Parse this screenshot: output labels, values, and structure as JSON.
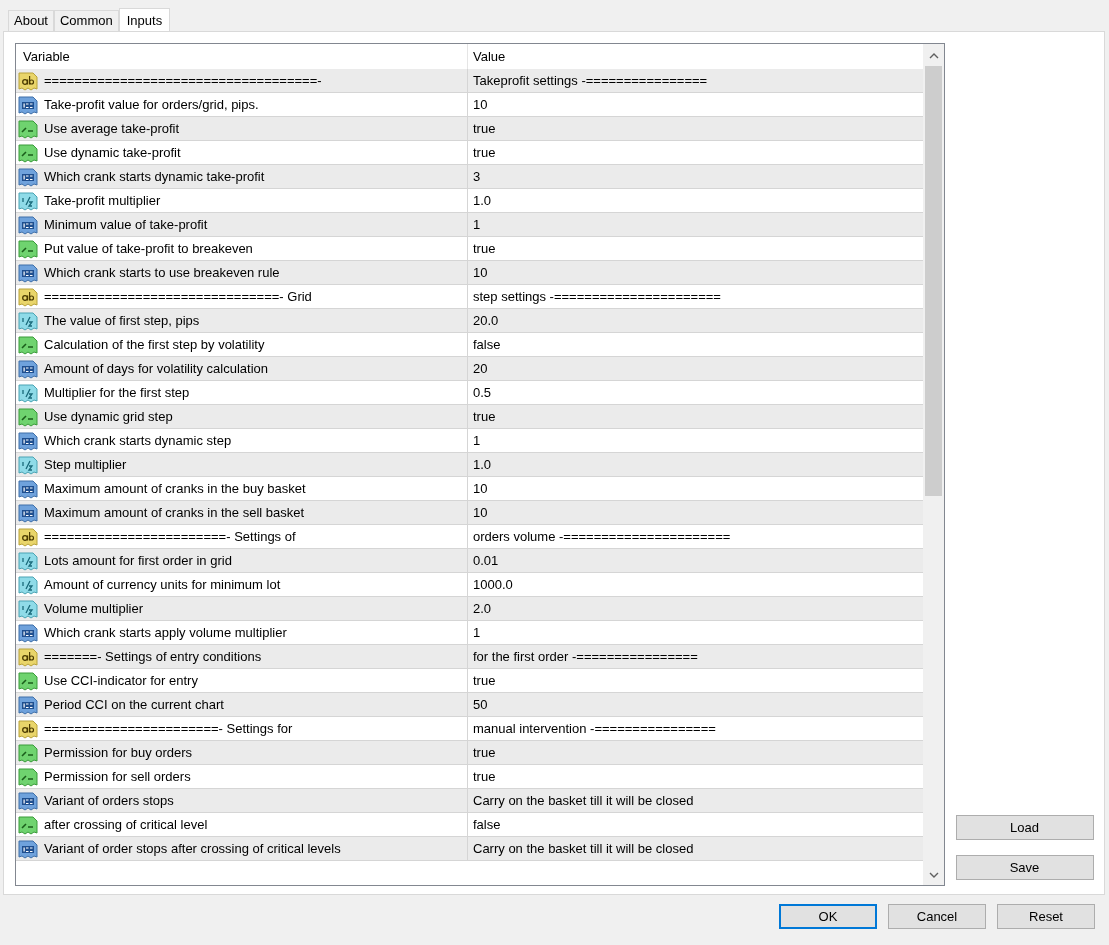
{
  "tabs": [
    {
      "label": "About",
      "selected": false
    },
    {
      "label": "Common",
      "selected": false
    },
    {
      "label": "Inputs",
      "selected": true
    }
  ],
  "table": {
    "columns": [
      "Variable",
      "Value"
    ],
    "rows": [
      {
        "kind": "string",
        "variable": "====================================-",
        "value": "Takeprofit settings -================"
      },
      {
        "kind": "int",
        "variable": "Take-profit value for orders/grid, pips.",
        "value": "10"
      },
      {
        "kind": "bool",
        "variable": "Use average take-profit",
        "value": "true"
      },
      {
        "kind": "bool",
        "variable": "Use dynamic take-profit",
        "value": "true"
      },
      {
        "kind": "int",
        "variable": "Which crank starts dynamic take-profit",
        "value": "3"
      },
      {
        "kind": "double",
        "variable": "Take-profit multiplier",
        "value": "1.0"
      },
      {
        "kind": "int",
        "variable": "Minimum value of take-profit",
        "value": "1"
      },
      {
        "kind": "bool",
        "variable": "Put value of take-profit to breakeven",
        "value": "true"
      },
      {
        "kind": "int",
        "variable": "Which crank starts to use breakeven rule",
        "value": "10"
      },
      {
        "kind": "string",
        "variable": "===============================- Grid",
        "value": "step settings -======================"
      },
      {
        "kind": "double",
        "variable": "The value of first step, pips",
        "value": "20.0"
      },
      {
        "kind": "bool",
        "variable": "Calculation of the first step by volatility",
        "value": "false"
      },
      {
        "kind": "int",
        "variable": "Amount of days for volatility calculation",
        "value": "20"
      },
      {
        "kind": "double",
        "variable": "Multiplier for the first step",
        "value": "0.5"
      },
      {
        "kind": "bool",
        "variable": "Use dynamic grid step",
        "value": "true"
      },
      {
        "kind": "int",
        "variable": "Which crank starts dynamic step",
        "value": "1"
      },
      {
        "kind": "double",
        "variable": "Step multiplier",
        "value": "1.0"
      },
      {
        "kind": "int",
        "variable": "Maximum amount of cranks in the buy basket",
        "value": "10"
      },
      {
        "kind": "int",
        "variable": "Maximum amount of cranks in the sell basket",
        "value": "10"
      },
      {
        "kind": "string",
        "variable": "========================- Settings of",
        "value": "orders volume -======================"
      },
      {
        "kind": "double",
        "variable": "Lots amount for first order in grid",
        "value": "0.01"
      },
      {
        "kind": "double",
        "variable": "Amount of currency units for minimum lot",
        "value": "1000.0"
      },
      {
        "kind": "double",
        "variable": "Volume multiplier",
        "value": "2.0"
      },
      {
        "kind": "int",
        "variable": "Which crank starts apply volume multiplier",
        "value": "1"
      },
      {
        "kind": "string",
        "variable": "=======- Settings of entry conditions",
        "value": "for the first order -================"
      },
      {
        "kind": "bool",
        "variable": "Use CCI-indicator for entry",
        "value": "true"
      },
      {
        "kind": "int",
        "variable": "Period CCI on the current chart",
        "value": "50"
      },
      {
        "kind": "string",
        "variable": "=======================- Settings for",
        "value": "manual intervention -================"
      },
      {
        "kind": "bool",
        "variable": "Permission for buy orders",
        "value": "true"
      },
      {
        "kind": "bool",
        "variable": "Permission for sell orders",
        "value": "true"
      },
      {
        "kind": "int",
        "variable": "Variant of orders stops",
        "value": "Carry on the basket till it will be closed"
      },
      {
        "kind": "bool",
        "variable": "after crossing of critical level",
        "value": "false"
      },
      {
        "kind": "int",
        "variable": "Variant of order stops after crossing of critical levels",
        "value": "Carry on the basket till it will be closed"
      }
    ]
  },
  "side_buttons": [
    "Load",
    "Save"
  ],
  "buttons": [
    {
      "label": "OK",
      "default": true
    },
    {
      "label": "Cancel",
      "default": false
    },
    {
      "label": "Reset",
      "default": false
    }
  ]
}
